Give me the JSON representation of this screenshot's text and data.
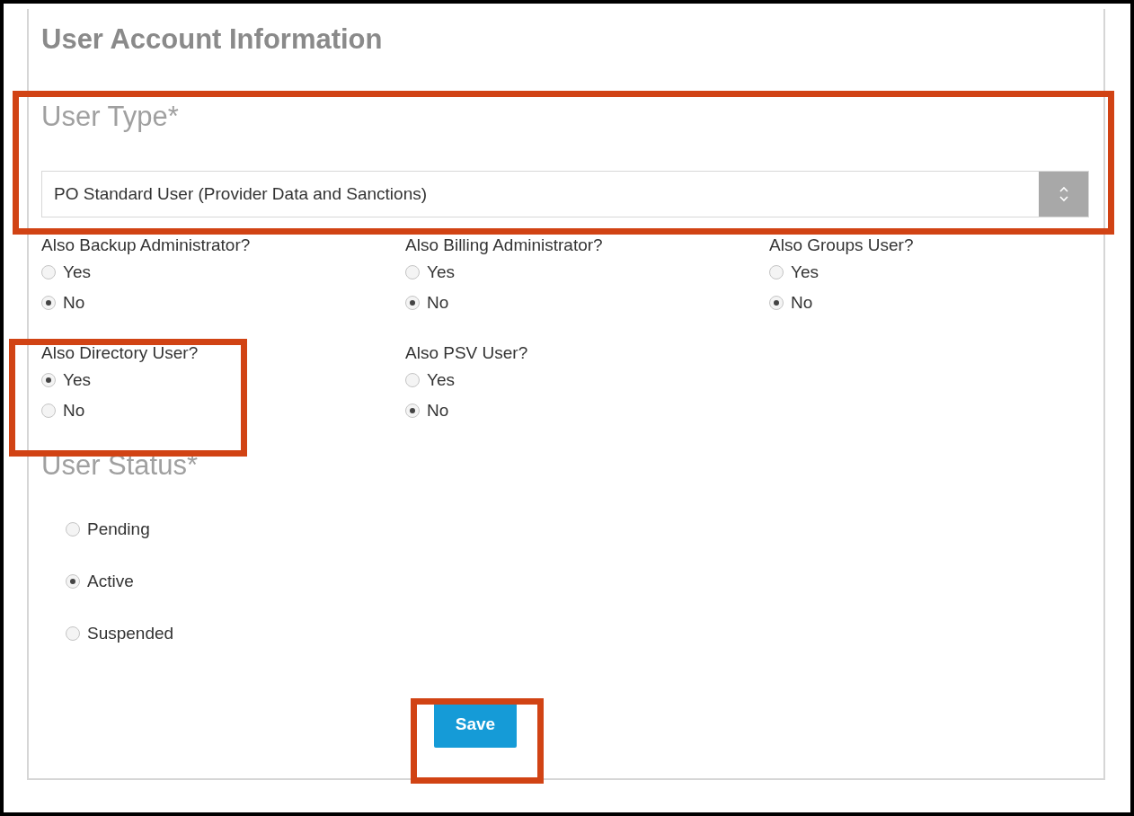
{
  "title": "User Account Information",
  "user_type": {
    "label": "User Type*",
    "value": "PO Standard User (Provider Data and Sanctions)"
  },
  "role_groups": [
    {
      "label": "Also Backup Administrator?",
      "options": [
        {
          "label": "Yes",
          "selected": false
        },
        {
          "label": "No",
          "selected": true
        }
      ]
    },
    {
      "label": "Also Billing Administrator?",
      "options": [
        {
          "label": "Yes",
          "selected": false
        },
        {
          "label": "No",
          "selected": true
        }
      ]
    },
    {
      "label": "Also Groups User?",
      "options": [
        {
          "label": "Yes",
          "selected": false
        },
        {
          "label": "No",
          "selected": true
        }
      ]
    },
    {
      "label": "Also Directory User?",
      "options": [
        {
          "label": "Yes",
          "selected": true
        },
        {
          "label": "No",
          "selected": false
        }
      ]
    },
    {
      "label": "Also PSV User?",
      "options": [
        {
          "label": "Yes",
          "selected": false
        },
        {
          "label": "No",
          "selected": true
        }
      ]
    }
  ],
  "user_status": {
    "label": "User Status*",
    "options": [
      {
        "label": "Pending",
        "selected": false
      },
      {
        "label": "Active",
        "selected": true
      },
      {
        "label": "Suspended",
        "selected": false
      }
    ]
  },
  "save_button": "Save"
}
